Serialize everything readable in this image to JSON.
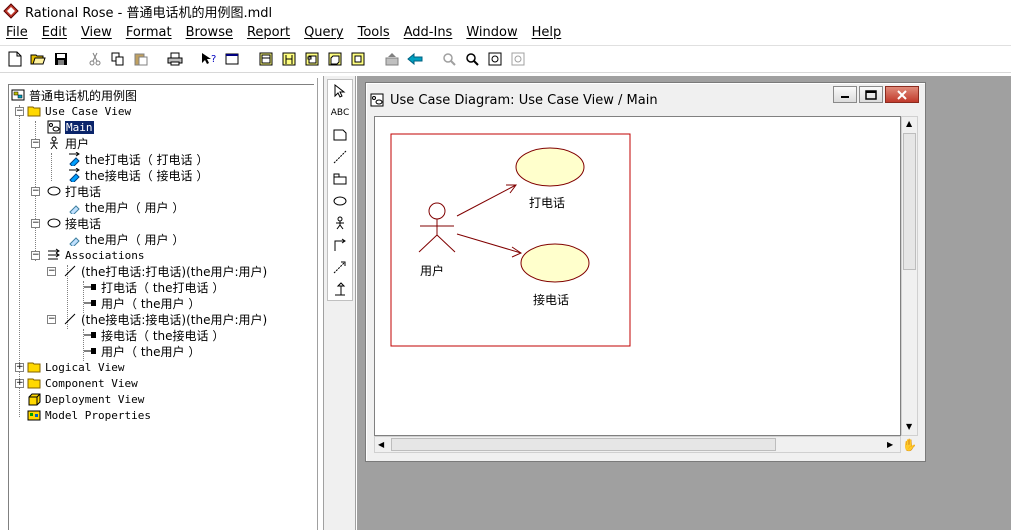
{
  "window": {
    "title": "Rational Rose - 普通电话机的用例图.mdl"
  },
  "menu": {
    "items": [
      "File",
      "Edit",
      "View",
      "Format",
      "Browse",
      "Report",
      "Query",
      "Tools",
      "Add-Ins",
      "Window",
      "Help"
    ]
  },
  "toolbar": {
    "buttons": [
      "new-icon",
      "open-icon",
      "save-icon",
      "cut-icon",
      "copy-icon",
      "paste-icon",
      "print-icon",
      "context-help-icon",
      "view-doc-icon",
      "browse-class-icon",
      "browse-interaction-icon",
      "browse-component-icon",
      "browse-deployment-icon",
      "browse-parent-icon",
      "browse-previous-icon",
      "zoom-in-icon",
      "zoom-out-icon",
      "fit-window-icon",
      "undo-fit-icon"
    ]
  },
  "browser": {
    "root": "普通电话机的用例图",
    "use_case_view": "Use Case View",
    "main": "Main",
    "actor_user": "用户",
    "assoc_call": "the打电话（ 打电话 ）",
    "assoc_answer": "the接电话（ 接电话 ）",
    "uc_call": "打电话",
    "uc_call_child": "the用户（ 用户 ）",
    "uc_answer": "接电话",
    "uc_answer_child": "the用户（ 用户 ）",
    "associations": "Associations",
    "assoc1": "(the打电话:打电话)(the用户:用户)",
    "assoc1_end1": "打电话（ the打电话 ）",
    "assoc1_end2": "用户（ the用户 ）",
    "assoc2": "(the接电话:接电话)(the用户:用户)",
    "assoc2_end1": "接电话（ the接电话 ）",
    "assoc2_end2": "用户（ the用户 ）",
    "logical_view": "Logical View",
    "component_view": "Component View",
    "deployment_view": "Deployment View",
    "model_properties": "Model Properties"
  },
  "palette": {
    "tools": [
      "selection-icon",
      "text-icon",
      "note-icon",
      "anchor-icon",
      "package-icon",
      "use-case-icon",
      "actor-icon",
      "unidirectional-association-icon",
      "dependency-icon",
      "generalization-icon"
    ],
    "text_tool_label": "ABC"
  },
  "diagram_window": {
    "title": "Use Case Diagram: Use Case View / Main",
    "actor_label": "用户",
    "uc1_label": "打电话",
    "uc2_label": "接电话"
  },
  "colors": {
    "boundary": "#c00000",
    "use_case_fill": "#ffffcc",
    "line": "#800000"
  }
}
